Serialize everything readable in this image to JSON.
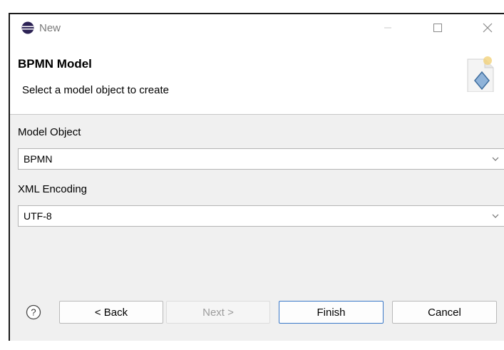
{
  "window": {
    "title": "New",
    "controls": {
      "minimize": "minimize",
      "maximize": "maximize",
      "close": "close"
    }
  },
  "header": {
    "title": "BPMN Model",
    "description": "Select a model object to create"
  },
  "form": {
    "model_object_label": "Model Object",
    "model_object_value": "BPMN",
    "xml_encoding_label": "XML Encoding",
    "xml_encoding_value": "UTF-8"
  },
  "buttons": {
    "back": "< Back",
    "next": "Next >",
    "finish": "Finish",
    "cancel": "Cancel"
  },
  "icons": {
    "app": "eclipse-icon",
    "wizard": "bpmn-wizard-icon",
    "help": "help-icon",
    "dropdown": "chevron-down-icon"
  },
  "colors": {
    "default_button_border": "#3a78c8",
    "disabled_text": "#9c9c9c"
  }
}
